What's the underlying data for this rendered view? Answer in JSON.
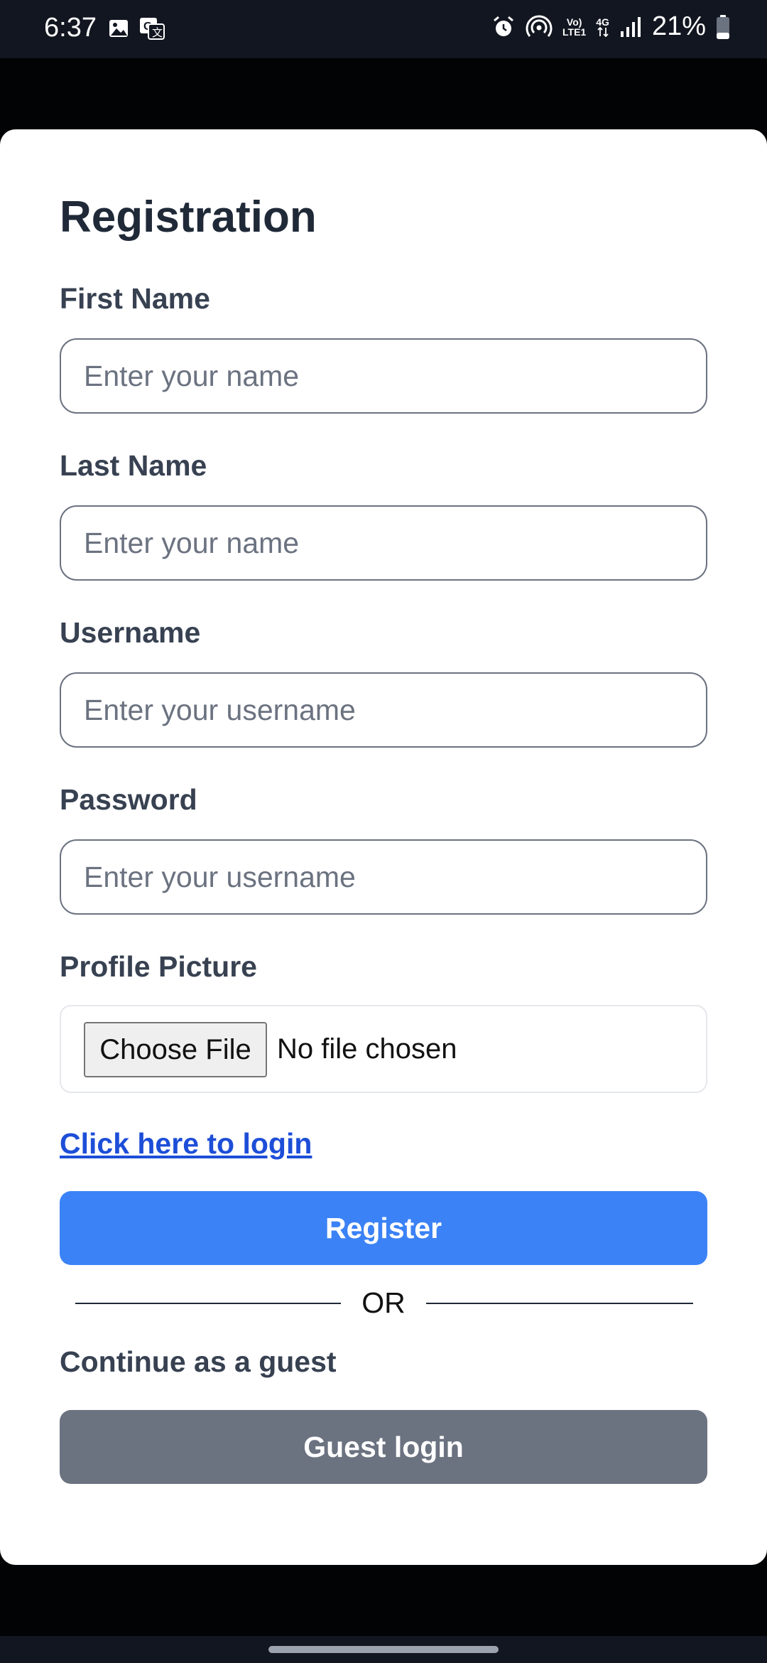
{
  "status_bar": {
    "time": "6:37",
    "battery": "21%",
    "network_top": "Vo)",
    "network_bottom": "LTE1",
    "data_type": "4G",
    "icons": [
      "gallery-icon",
      "translate-icon",
      "alarm-icon",
      "hotspot-icon",
      "volte-icon",
      "signal-icon",
      "battery-icon"
    ]
  },
  "form": {
    "title": "Registration",
    "first_name": {
      "label": "First Name",
      "placeholder": "Enter your name",
      "value": ""
    },
    "last_name": {
      "label": "Last Name",
      "placeholder": "Enter your name",
      "value": ""
    },
    "username": {
      "label": "Username",
      "placeholder": "Enter your username",
      "value": ""
    },
    "password": {
      "label": "Password",
      "placeholder": "Enter your username",
      "value": ""
    },
    "profile_picture": {
      "label": "Profile Picture",
      "button": "Choose File",
      "status": "No file chosen"
    },
    "login_link": "Click here to login",
    "register_button": "Register",
    "or_text": "OR",
    "guest_text": "Continue as a guest",
    "guest_button": "Guest login"
  },
  "colors": {
    "primary": "#3b82f6",
    "secondary": "#6b7280",
    "link": "#1d4ed8",
    "heading": "#1f2937",
    "label": "#374151"
  }
}
